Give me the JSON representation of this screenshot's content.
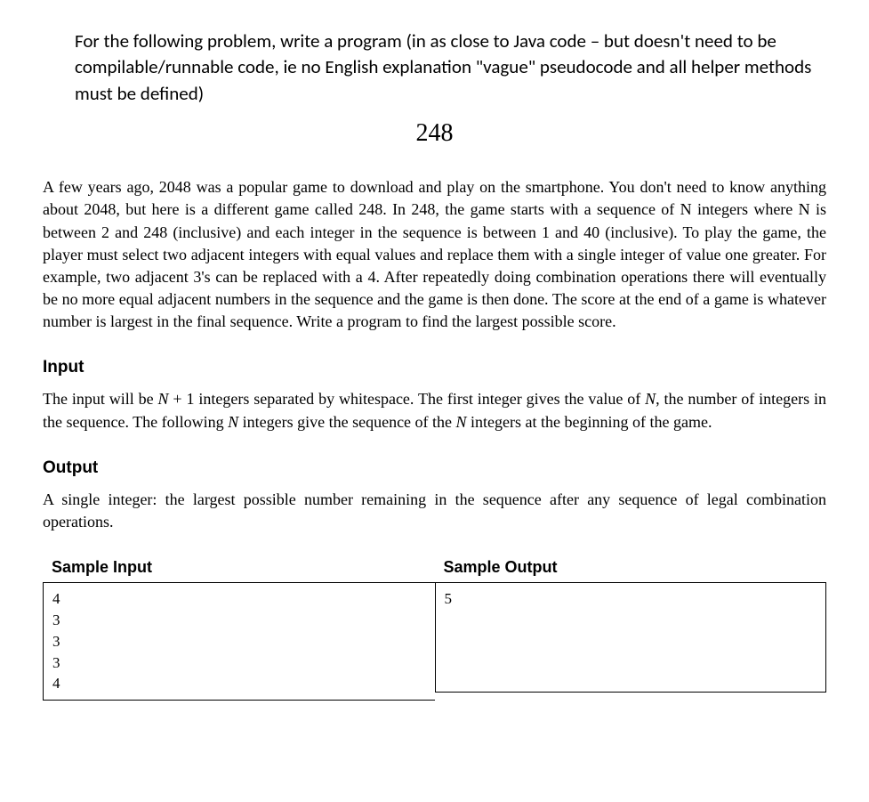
{
  "instruction": "For the following problem, write a program (in as close to Java code – but doesn't need to be compilable/runnable code, ie no English explanation \"vague\" pseudocode and all helper methods must be defined)",
  "title": "248",
  "description": "A few years ago, 2048 was a popular game to download and play on the smartphone. You don't need to know anything about 2048, but here is a different game called 248. In 248, the game starts with a sequence of N integers where N is between 2 and 248 (inclusive) and each integer in the sequence is between 1 and 40 (inclusive). To play the game, the player must select two adjacent integers with equal values and replace them with a single integer of value one greater. For example, two adjacent 3's can be replaced with a 4. After repeatedly doing combination operations there will eventually be no more equal adjacent numbers in the sequence and the game is then done. The score at the end of a game is whatever number is largest in the final sequence. Write a program to find the largest possible score.",
  "input_heading": "Input",
  "input_text_pre": "The input will be ",
  "input_text_it1": "N",
  "input_text_mid1": " + 1 integers separated by whitespace. The first integer gives the value of ",
  "input_text_it2": "N",
  "input_text_mid2": ", the number of integers in the sequence. The following ",
  "input_text_it3": "N",
  "input_text_mid3": " integers give the sequence of the ",
  "input_text_it4": "N",
  "input_text_post": " integers at the beginning of the game.",
  "output_heading": "Output",
  "output_text": "A single integer: the largest possible number remaining in the sequence after any sequence of legal combination operations.",
  "sample_input_heading": "Sample Input",
  "sample_output_heading": "Sample Output",
  "sample_input": "4\n3\n3\n3\n4",
  "sample_output": "5"
}
